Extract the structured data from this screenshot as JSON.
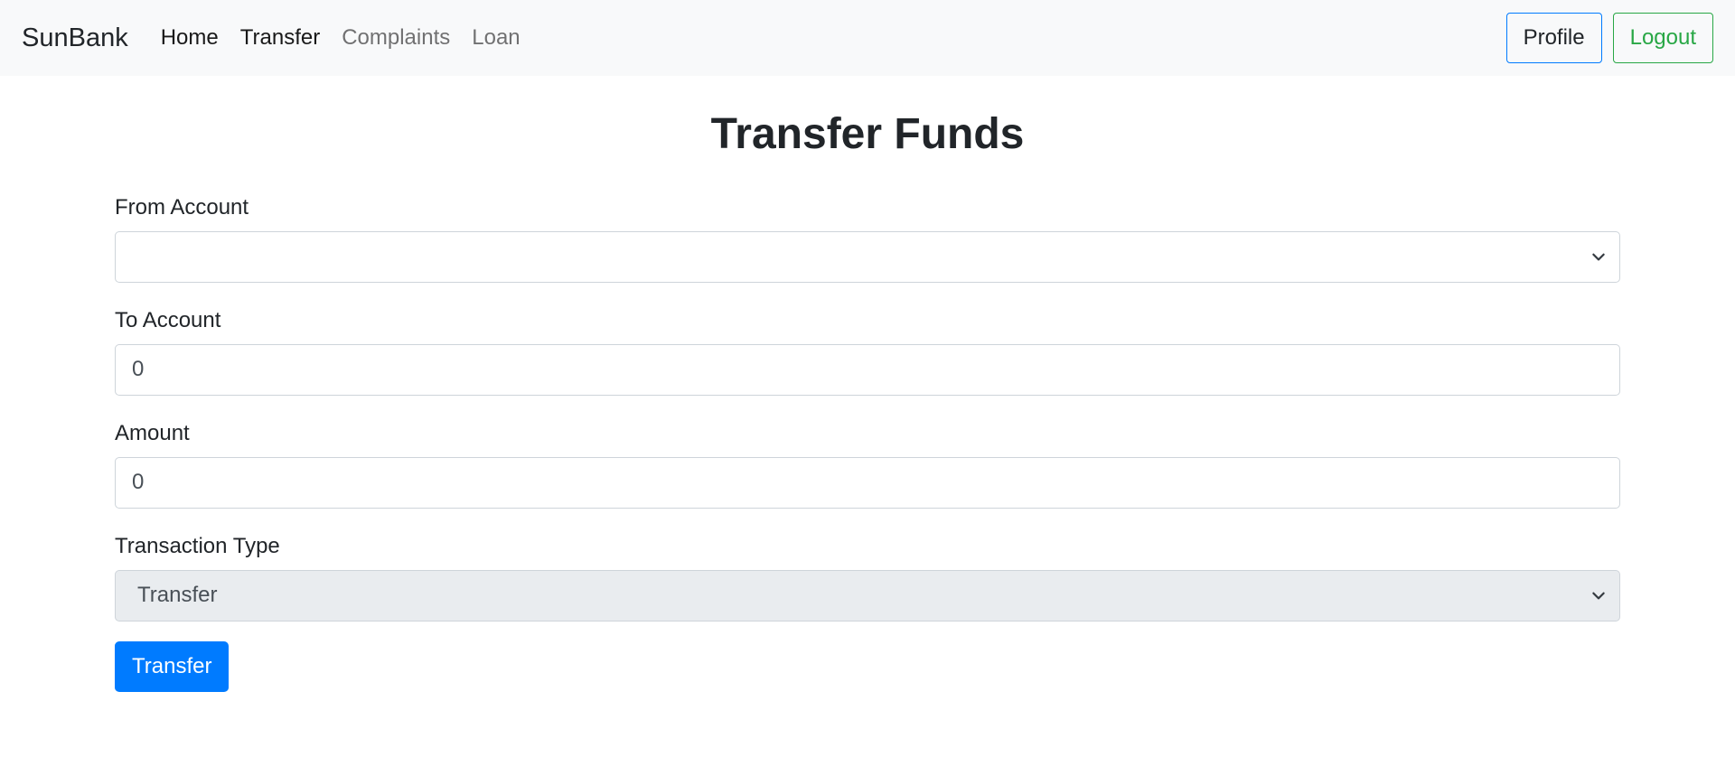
{
  "navbar": {
    "brand": "SunBank",
    "links": [
      {
        "label": "Home",
        "active": true
      },
      {
        "label": "Transfer",
        "active": true
      },
      {
        "label": "Complaints",
        "active": false
      },
      {
        "label": "Loan",
        "active": false
      }
    ],
    "profile_label": "Profile",
    "logout_label": "Logout"
  },
  "page": {
    "title": "Transfer Funds"
  },
  "form": {
    "from_account": {
      "label": "From Account",
      "value": ""
    },
    "to_account": {
      "label": "To Account",
      "value": "0"
    },
    "amount": {
      "label": "Amount",
      "value": "0"
    },
    "transaction_type": {
      "label": "Transaction Type",
      "value": "Transfer"
    },
    "submit_label": "Transfer"
  },
  "icons": {
    "select_arrow": "chevron-down-icon"
  },
  "colors": {
    "primary": "#007bff",
    "success": "#28a745",
    "navbar_bg": "#f8f9fa",
    "disabled_bg": "#e9ecef"
  }
}
